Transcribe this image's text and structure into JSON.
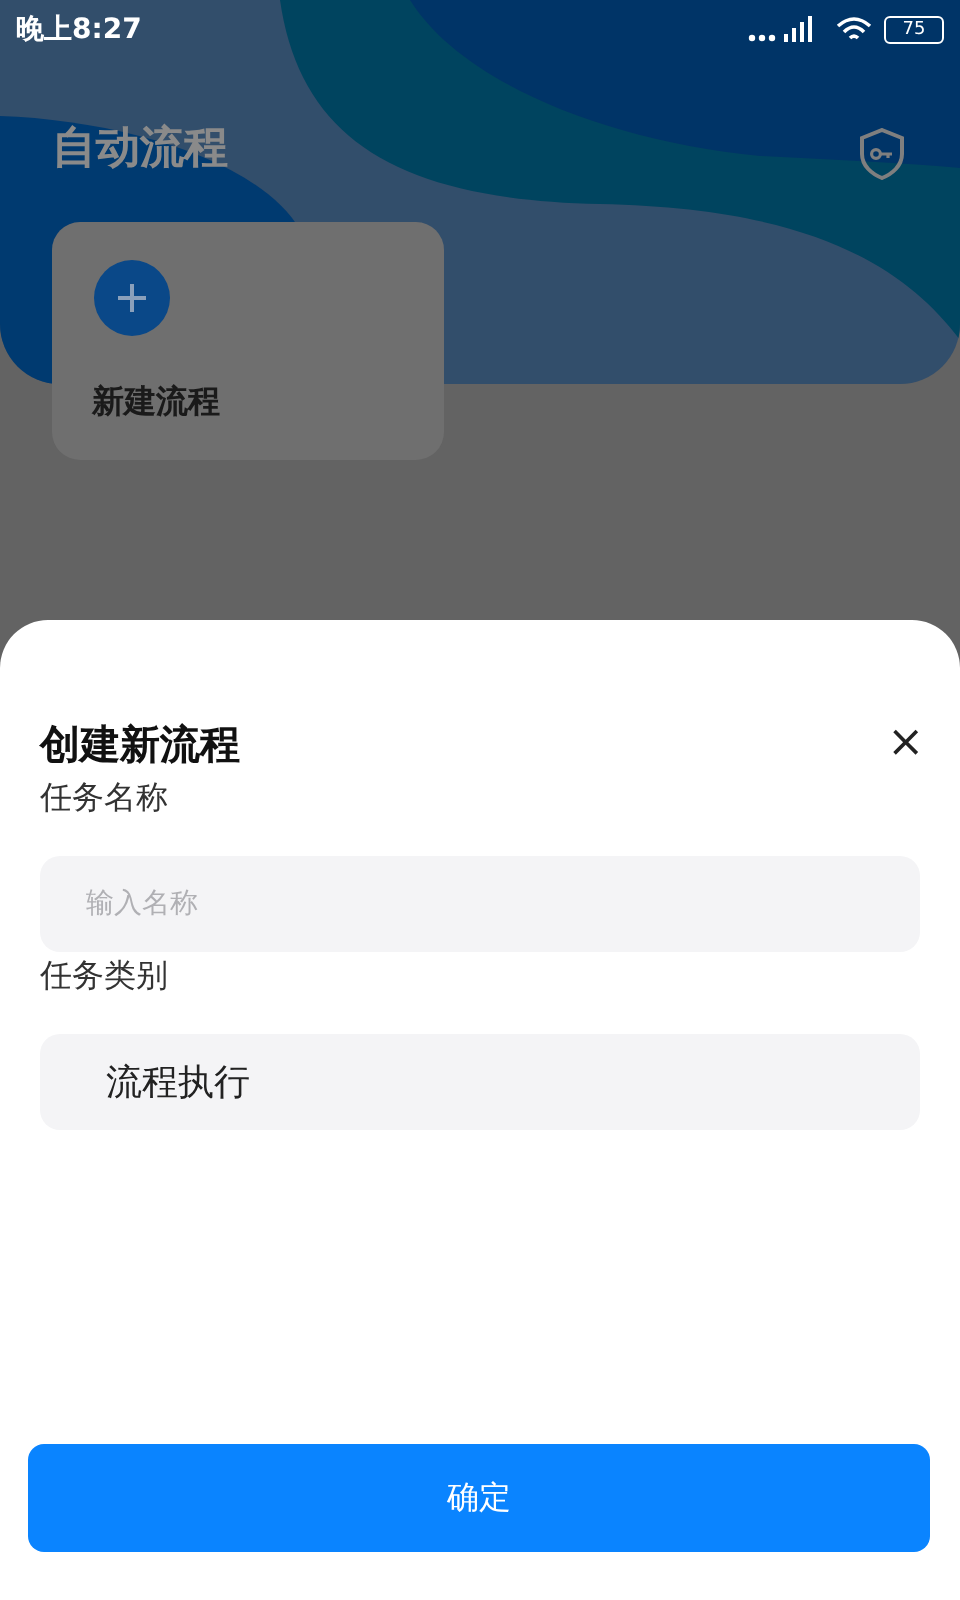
{
  "status_bar": {
    "time": "晚上8:27",
    "battery": "75"
  },
  "page": {
    "title": "自动流程",
    "cards": [
      {
        "label": "新建流程"
      }
    ]
  },
  "sheet": {
    "title": "创建新流程",
    "close": "×",
    "fields": [
      {
        "kind": "input",
        "label": "任务名称",
        "placeholder": "输入名称"
      },
      {
        "kind": "select",
        "label": "任务类别",
        "value": "流程执行"
      }
    ],
    "button": "确定"
  }
}
